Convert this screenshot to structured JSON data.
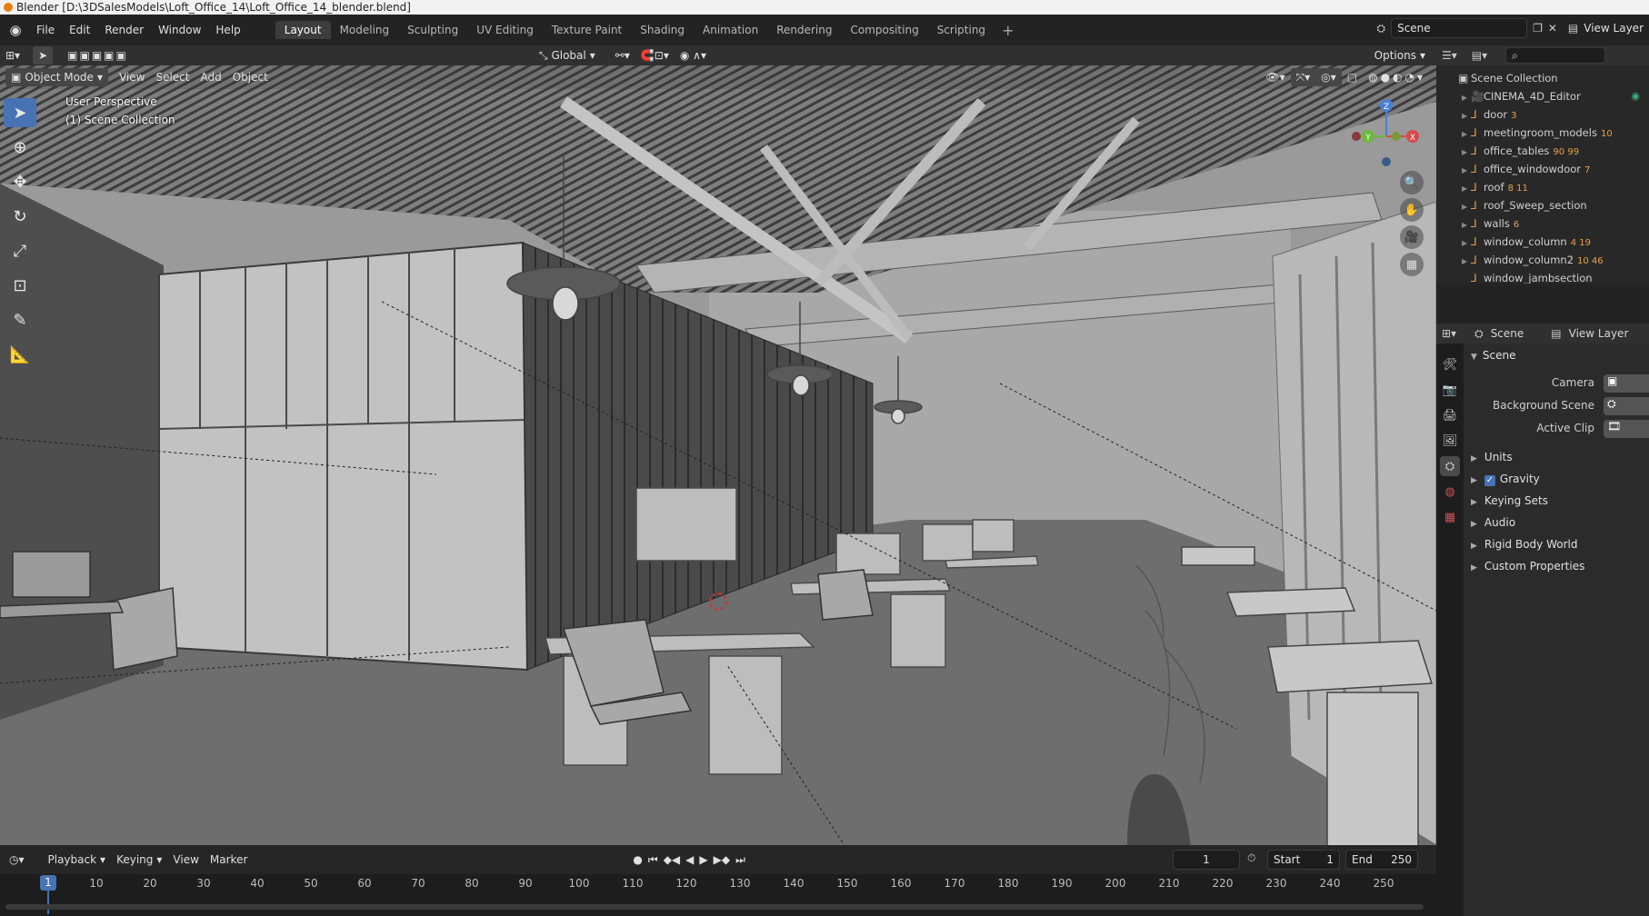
{
  "window": {
    "title": "Blender [D:\\3DSalesModels\\Loft_Office_14\\Loft_Office_14_blender.blend]"
  },
  "menu": [
    "File",
    "Edit",
    "Render",
    "Window",
    "Help"
  ],
  "workspaces": [
    {
      "label": "Layout",
      "active": true
    },
    {
      "label": "Modeling"
    },
    {
      "label": "Sculpting"
    },
    {
      "label": "UV Editing"
    },
    {
      "label": "Texture Paint"
    },
    {
      "label": "Shading"
    },
    {
      "label": "Animation"
    },
    {
      "label": "Rendering"
    },
    {
      "label": "Compositing"
    },
    {
      "label": "Scripting"
    }
  ],
  "topbar": {
    "scene": "Scene",
    "view_layer": "View Layer"
  },
  "viewport_header": {
    "transform_orientation": "Global",
    "options": "Options",
    "mode": "Object Mode",
    "menus": [
      "View",
      "Select",
      "Add",
      "Object"
    ]
  },
  "viewport": {
    "perspective": "User Perspective",
    "collection": "(1) Scene Collection",
    "gizmo_axes": [
      "X",
      "Y",
      "Z"
    ]
  },
  "outliner": {
    "root": "Scene Collection",
    "items": [
      {
        "name": "CINEMA_4D_Editor",
        "badge": ""
      },
      {
        "name": "door",
        "badge": "3"
      },
      {
        "name": "meetingroom_models",
        "badge": "10"
      },
      {
        "name": "office_tables",
        "badge": "90 99"
      },
      {
        "name": "office_windowdoor",
        "badge": "7"
      },
      {
        "name": "roof",
        "badge": "8 11"
      },
      {
        "name": "roof_Sweep_section",
        "badge": ""
      },
      {
        "name": "walls",
        "badge": "6"
      },
      {
        "name": "window_column",
        "badge": "4 19"
      },
      {
        "name": "window_column2",
        "badge": "10 46"
      },
      {
        "name": "window_jambsection",
        "badge": ""
      }
    ]
  },
  "properties": {
    "tab_scene": "Scene",
    "tab_view_layer": "View Layer",
    "section": "Scene",
    "fields": [
      {
        "label": "Camera"
      },
      {
        "label": "Background Scene"
      },
      {
        "label": "Active Clip"
      }
    ],
    "panels": [
      "Units",
      "Gravity",
      "Keying Sets",
      "Audio",
      "Rigid Body World",
      "Custom Properties"
    ]
  },
  "timeline": {
    "menus": [
      "Playback",
      "Keying",
      "View",
      "Marker"
    ],
    "current_frame": "1",
    "start_label": "Start",
    "start": "1",
    "end_label": "End",
    "end": "250",
    "ruler": [
      "1",
      "10",
      "20",
      "30",
      "40",
      "50",
      "60",
      "70",
      "80",
      "90",
      "100",
      "110",
      "120",
      "130",
      "140",
      "150",
      "160",
      "170",
      "180",
      "190",
      "200",
      "210",
      "220",
      "230",
      "240",
      "250"
    ]
  }
}
